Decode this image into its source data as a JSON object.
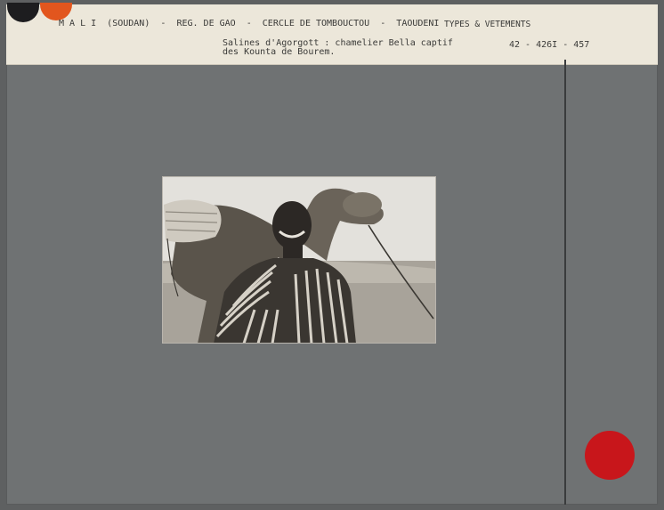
{
  "header": {
    "location": "M A L I  (SOUDAN)  -  REG. DE GAO  -  CERCLE DE TOMBOUCTOU  -  TAOUDENI",
    "category": "TYPES & VETEMENTS",
    "caption_line1": "Salines d'Agorgott : chamelier Bella captif",
    "caption_line2": "des Kounta de Bourem.",
    "reference": "42 - 426I - 457"
  },
  "colors": {
    "card": "#6f7273",
    "label": "#ece7da",
    "stamp_red": "#c8161b",
    "stamp_orange": "#e2561e",
    "stamp_black": "#1d1d1f"
  },
  "photo": {
    "subject": "camel-driver-with-camel"
  }
}
